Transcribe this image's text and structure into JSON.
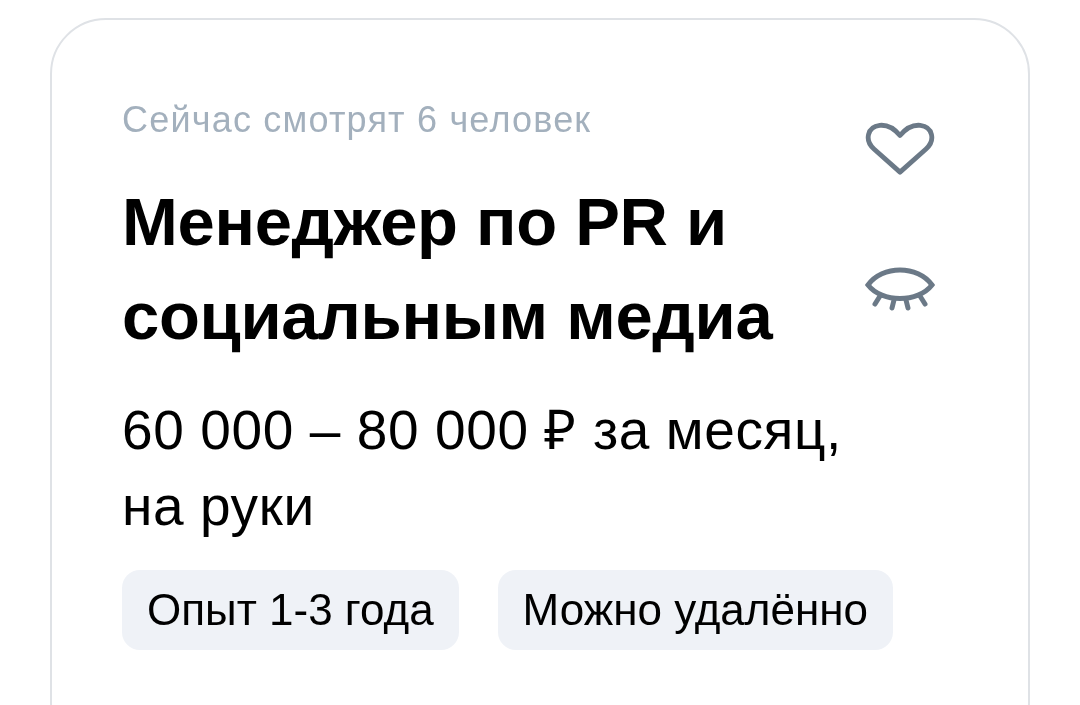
{
  "vacancy": {
    "viewers": "Сейчас смотрят 6 человек",
    "title": "Менеджер по PR и социальным медиа",
    "favorited": false,
    "salary": "60 000 – 80 000 ₽ за месяц, на руки",
    "tags": [
      {
        "label": "Опыт 1-3 года"
      },
      {
        "label": "Можно удалённо"
      }
    ]
  }
}
